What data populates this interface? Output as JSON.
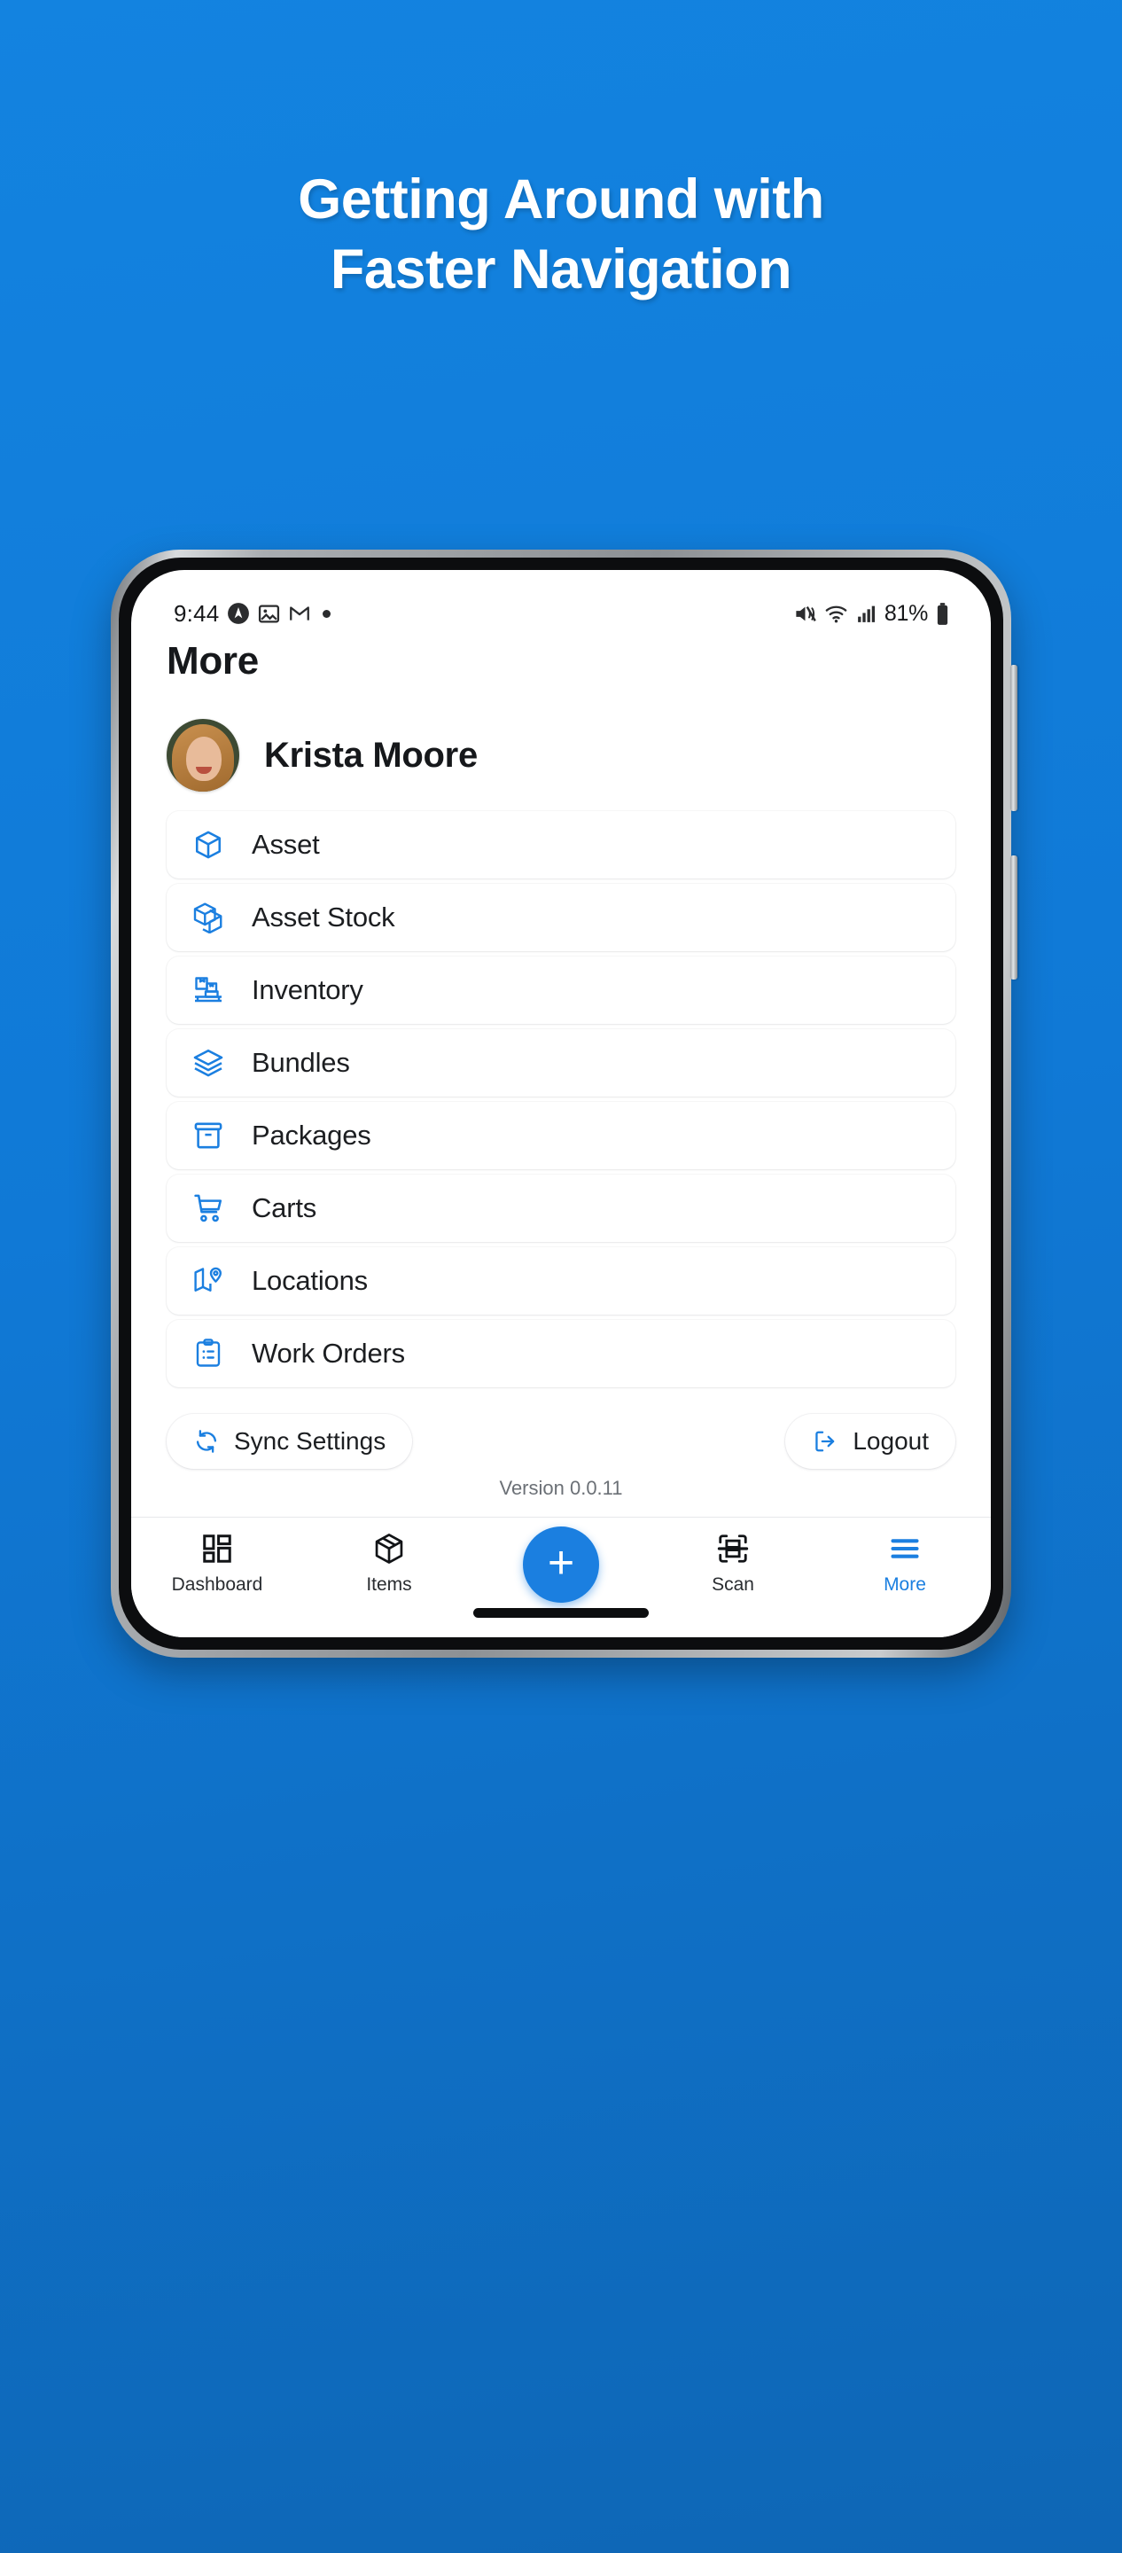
{
  "promo": {
    "headline_line1": "Getting Around with",
    "headline_line2": "Faster Navigation",
    "background_color": "#1079d6",
    "accent_color": "#1b7fe0"
  },
  "statusbar": {
    "time": "9:44",
    "battery_percent": "81%",
    "icons_left": [
      "compass-icon",
      "image-icon",
      "gmail-icon",
      "dot-icon"
    ],
    "icons_right": [
      "mute-icon",
      "wifi-icon",
      "signal-icon",
      "battery-icon"
    ]
  },
  "header": {
    "title": "More"
  },
  "profile": {
    "name": "Krista Moore",
    "avatar": "user-avatar"
  },
  "menu": {
    "items": [
      {
        "label": "Asset",
        "icon": "cube-icon"
      },
      {
        "label": "Asset Stock",
        "icon": "cubes-icon"
      },
      {
        "label": "Inventory",
        "icon": "boxes-pallet-icon"
      },
      {
        "label": "Bundles",
        "icon": "layers-icon"
      },
      {
        "label": "Packages",
        "icon": "archive-box-icon"
      },
      {
        "label": "Carts",
        "icon": "shopping-cart-icon"
      },
      {
        "label": "Locations",
        "icon": "map-pin-icon"
      },
      {
        "label": "Work Orders",
        "icon": "clipboard-list-icon"
      }
    ]
  },
  "actions": {
    "sync_label": "Sync Settings",
    "sync_icon": "refresh-icon",
    "logout_label": "Logout",
    "logout_icon": "logout-icon"
  },
  "version": "Version 0.0.11",
  "bottomnav": {
    "items": [
      {
        "label": "Dashboard",
        "icon": "grid-icon",
        "active": false
      },
      {
        "label": "Items",
        "icon": "box-3d-icon",
        "active": false
      },
      {
        "label": "Scan",
        "icon": "barcode-scan-icon",
        "active": false
      },
      {
        "label": "More",
        "icon": "hamburger-icon",
        "active": true
      }
    ],
    "fab_label": "+",
    "fab_icon": "plus-icon"
  }
}
